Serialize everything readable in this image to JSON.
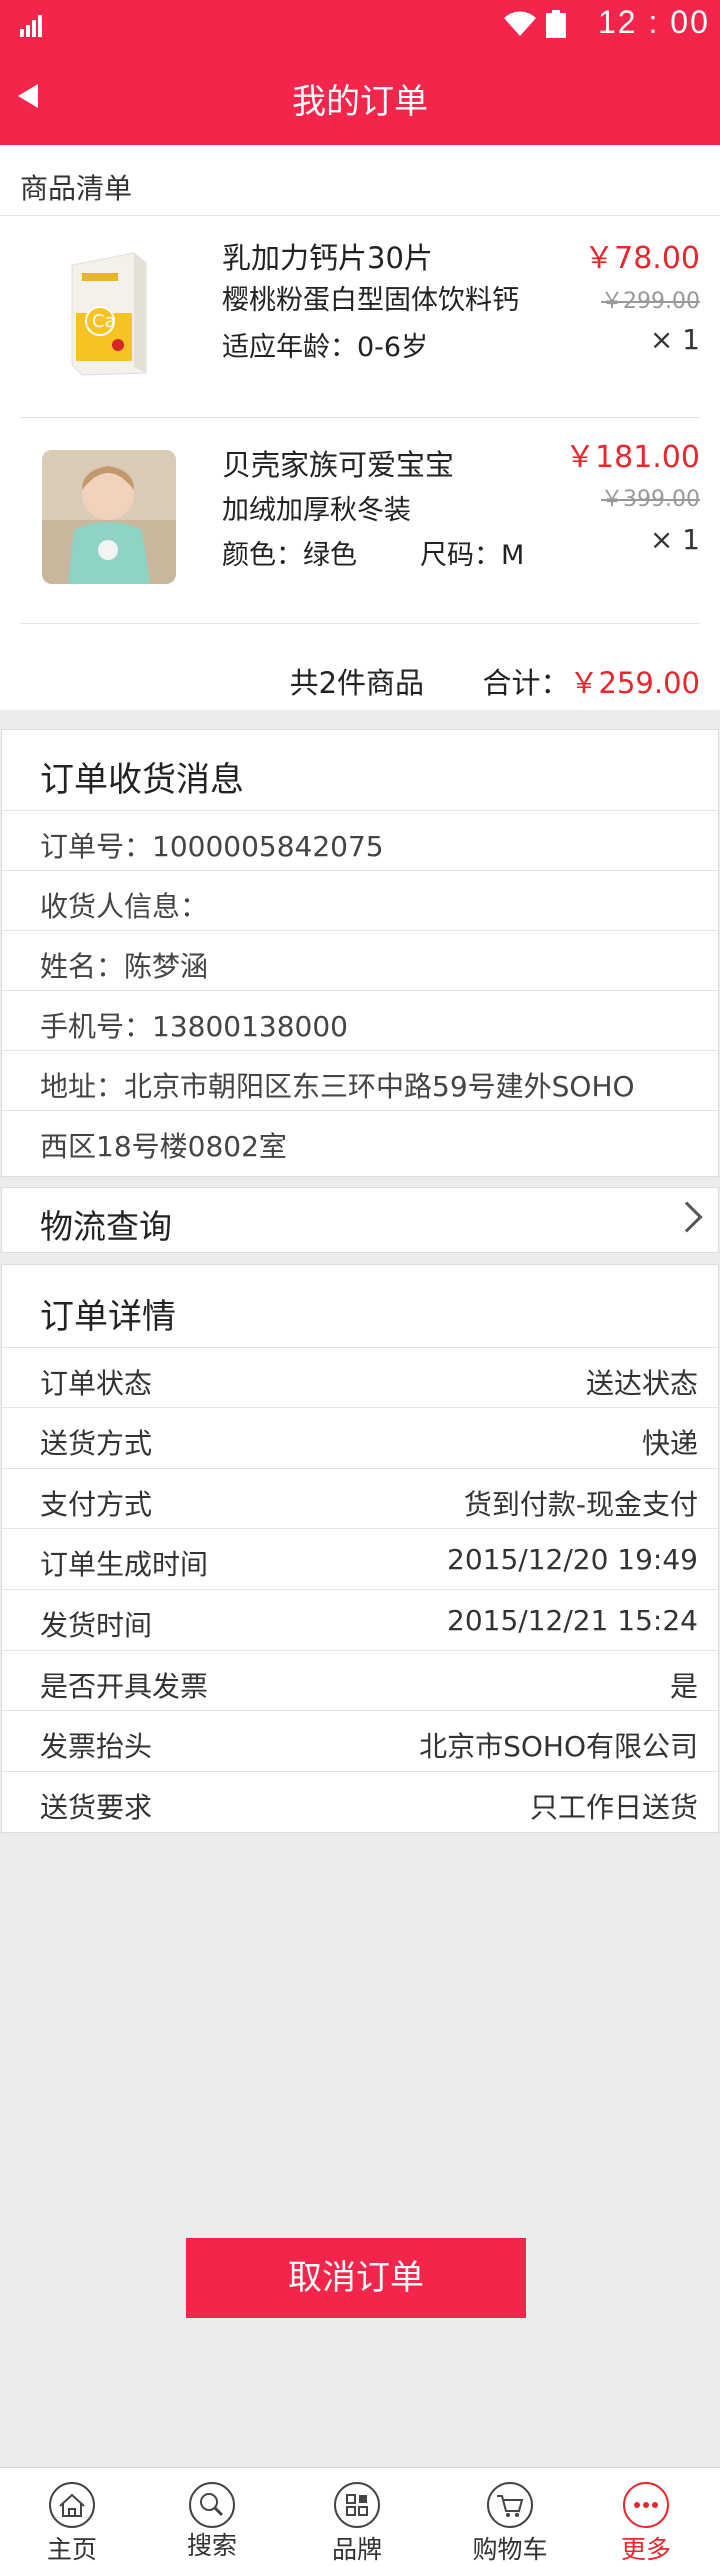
{
  "status_bar": {
    "time": "12 : 00"
  },
  "header": {
    "title": "我的订单"
  },
  "goods": {
    "section_title": "商品清单",
    "items": [
      {
        "name": "乳加力钙片30片",
        "desc": "樱桃粉蛋白型固体饮料钙",
        "spec": "适应年龄：0-6岁",
        "price": "￥78.00",
        "original_price": "￥299.00",
        "qty": "× 1"
      },
      {
        "name": "贝壳家族可爱宝宝",
        "desc": "加绒加厚秋冬装",
        "spec": "颜色：绿色",
        "spec2": "尺码：M",
        "price": "￥181.00",
        "original_price": "￥399.00",
        "qty": "× 1"
      }
    ],
    "count_text": "共2件商品",
    "total_label": "合计：",
    "total": "￥259.00"
  },
  "receive": {
    "title": "订单收货消息",
    "order_no": "订单号：1000005842075",
    "receiver_label": "收货人信息：",
    "name": "姓名：陈梦涵",
    "phone": "手机号：13800138000",
    "address_line1": "地址：北京市朝阳区东三环中路59号建外SOHO",
    "address_line2": "西区18号楼0802室"
  },
  "logistics": {
    "label": "物流查询"
  },
  "detail": {
    "title": "订单详情",
    "rows": [
      {
        "k": "订单状态",
        "v": "送达状态"
      },
      {
        "k": "送货方式",
        "v": "快递"
      },
      {
        "k": "支付方式",
        "v": "货到付款-现金支付"
      },
      {
        "k": "订单生成时间",
        "v": "2015/12/20 19:49"
      },
      {
        "k": "发货时间",
        "v": "2015/12/21 15:24"
      },
      {
        "k": "是否开具发票",
        "v": "是"
      },
      {
        "k": "发票抬头",
        "v": "北京市SOHO有限公司"
      },
      {
        "k": "送货要求",
        "v": "只工作日送货"
      }
    ]
  },
  "cancel_button": "取消订单",
  "tabbar": {
    "items": [
      {
        "label": "主页",
        "icon": "home-icon"
      },
      {
        "label": "搜索",
        "icon": "search-icon"
      },
      {
        "label": "品牌",
        "icon": "brand-grid-icon"
      },
      {
        "label": "购物车",
        "icon": "cart-icon"
      },
      {
        "label": "更多",
        "icon": "more-icon"
      }
    ],
    "active": "更多"
  },
  "colors": {
    "brand": "#f4254a",
    "price": "#e8262c"
  }
}
